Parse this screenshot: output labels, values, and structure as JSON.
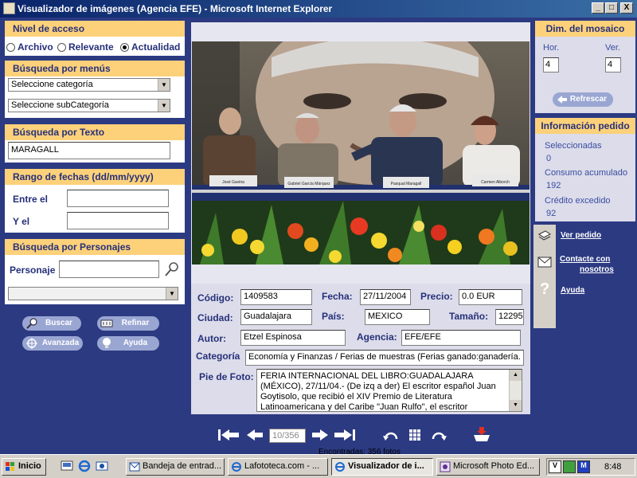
{
  "window": {
    "title": "Visualizador de imágenes (Agencia EFE) - Microsoft Internet Explorer",
    "minimize": "_",
    "maximize": "□",
    "close": "X"
  },
  "left": {
    "access": {
      "heading": "Nivel de acceso",
      "options": [
        "Archivo",
        "Relevante",
        "Actualidad"
      ],
      "selected": "Actualidad"
    },
    "menus": {
      "heading": "Búsqueda por menús",
      "category": "Seleccione categoría",
      "subcategory": "Seleccione subCategoría"
    },
    "text_search": {
      "heading": "Búsqueda por Texto",
      "value": "MARAGALL"
    },
    "dates": {
      "heading": "Rango de fechas (dd/mm/yyyy)",
      "from_label": "Entre el",
      "to_label": "Y el",
      "from_value": "",
      "to_value": ""
    },
    "people": {
      "heading": "Búsqueda por Personajes",
      "label": "Personaje",
      "value": "",
      "select_value": ""
    },
    "buttons": {
      "search": "Buscar",
      "refine": "Refinar",
      "advanced": "Avanzada",
      "help": "Ayuda"
    }
  },
  "photo": {
    "nameplates": [
      "José Gaviria",
      "Gabriel García Márquez",
      "Pasqual Maragall",
      "Carmen Alborch"
    ]
  },
  "details": {
    "codigo_label": "Código:",
    "codigo": "1409583",
    "fecha_label": "Fecha:",
    "fecha": "27/11/2004",
    "precio_label": "Precio:",
    "precio": "0.0  EUR",
    "ciudad_label": "Ciudad:",
    "ciudad": "Guadalajara",
    "pais_label": "País:",
    "pais": "MEXICO",
    "tamano_label": "Tamaño:",
    "tamano": "12295",
    "autor_label": "Autor:",
    "autor": "Etzel Espinosa",
    "agencia_label": "Agencia:",
    "agencia": "EFE/EFE",
    "categoria_label": "Categoría",
    "categoria": "Economía y Finanzas / Ferias de muestras (Ferias ganado:ganadería. Fe",
    "pie_label": "Pie de Foto:",
    "pie": "FERIA INTERNACIONAL DEL LIBRO:GUADALAJARA (MÉXICO), 27/11/04.- (De izq a der) El escritor español Juan Goytisolo, que recibió el XIV Premio de Literatura Latinoamericana y del Caribe \"Juan Rulfo\", el escritor colombiano radicado en"
  },
  "nav": {
    "counter": "10/356",
    "found": "Encontradas: 356 fotos"
  },
  "right": {
    "mosaic": {
      "heading": "Dim. del mosaico",
      "hor_label": "Hor.",
      "ver_label": "Ver.",
      "hor": "4",
      "ver": "4",
      "refresh": "Refrescar"
    },
    "order": {
      "heading": "Información pedido",
      "selected_label": "Seleccionadas",
      "selected": "0",
      "consumption_label": "Consumo acumulado",
      "consumption": "192",
      "credit_label": "Crédito excedido",
      "credit": "92"
    },
    "links": {
      "view_order": "Ver pedido",
      "contact_1": "Contacte con",
      "contact_2": "nosotros",
      "help": "Ayuda"
    }
  },
  "taskbar": {
    "start": "Inicio",
    "tasks": [
      "Bandeja de entrad...",
      "Lafototeca.com - ...",
      "Visualizador de i...",
      "Microsoft Photo Ed..."
    ],
    "active_index": 2,
    "clock": "8:48"
  }
}
